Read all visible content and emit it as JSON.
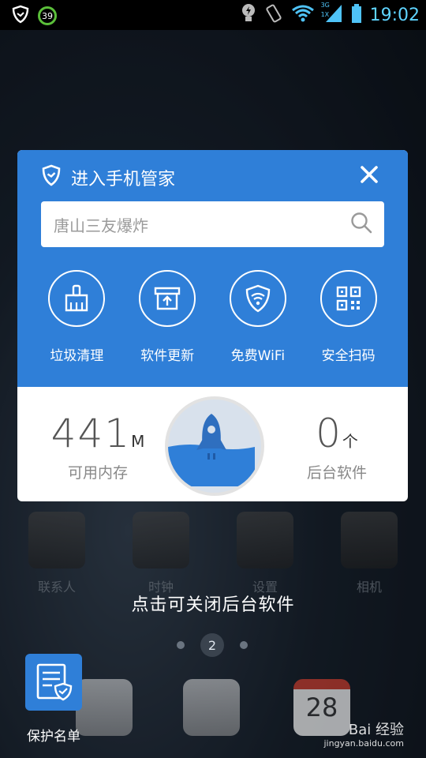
{
  "status_bar": {
    "battery_badge": "39",
    "time": "19:02",
    "network_labels": [
      "3G",
      "1X"
    ]
  },
  "panel": {
    "title": "进入手机管家",
    "search": {
      "value": "唐山三友爆炸",
      "placeholder": "唐山三友爆炸"
    },
    "tools": [
      {
        "label": "垃圾清理",
        "icon": "broom-icon"
      },
      {
        "label": "软件更新",
        "icon": "upload-box-icon"
      },
      {
        "label": "免费WiFi",
        "icon": "wifi-shield-icon"
      },
      {
        "label": "安全扫码",
        "icon": "qr-code-icon"
      }
    ],
    "memory": {
      "value": "441",
      "unit": "M",
      "label": "可用内存"
    },
    "background_apps": {
      "value": "0",
      "unit": "个",
      "label": "后台软件"
    },
    "colors": {
      "accent": "#2f7fd8"
    }
  },
  "home": {
    "apps": [
      "联系人",
      "时钟",
      "设置",
      "相机"
    ],
    "hint": "点击可关闭后台软件",
    "page_indicator": "2",
    "dock_date": "28"
  },
  "shortcut": {
    "label": "保护名单"
  },
  "watermark": {
    "brand": "Bai 经验",
    "url": "jingyan.baidu.com"
  }
}
